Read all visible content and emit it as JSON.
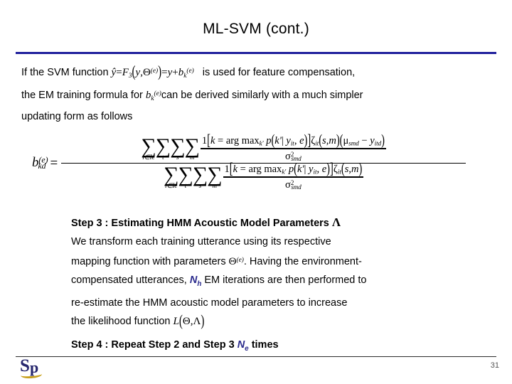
{
  "slide": {
    "title": "ML-SVM (cont.)",
    "page_number": "31",
    "accent_rule_color": "#1f1f9c",
    "footer_rule_color": "#2a2a2a",
    "highlight_variable_color": "#2a2a8c"
  },
  "logo": {
    "letter_s": "S",
    "letter_p": "p",
    "swoosh_color": "#c8a11e",
    "text_color": "#27276e"
  },
  "intro": {
    "line1_before": "If the SVM function",
    "line1_after": "is used for feature compensation,",
    "line2_before": "the EM training formula for",
    "line2_after": "can be derived similarly with a much simpler",
    "line3": "updating form as follows",
    "inline_formula_1": "ŷ = F3(y, Θ^(e)) = y + bk^(e)",
    "inline_formula_2": "bk^(e)",
    "f_label": "F",
    "f_sub": "3",
    "y_hat": "ŷ",
    "equals": "=",
    "y": "y",
    "theta": "Θ",
    "e_exp": "(e)",
    "plus": "+",
    "b": "b",
    "k_sub": "k",
    "comma": ","
  },
  "equation": {
    "lhs": "b",
    "lhs_sub": "kd",
    "lhs_sup": "(e)",
    "equals": "=",
    "numerator": {
      "sums": [
        {
          "sigma": "∑",
          "limit": "i∈Ie"
        },
        {
          "sigma": "∑",
          "limit": "t"
        },
        {
          "sigma": "∑",
          "limit": "s"
        },
        {
          "sigma": "∑",
          "limit": "m"
        }
      ],
      "frac_numerator": "1[k = arg maxk' p(k'| yit, e)] ζit(s, m)(μsmd − yitd)",
      "frac_denominator": "σ²smd",
      "parts": {
        "one": "1",
        "bracket_open": "[",
        "k": "k",
        "eq": "=",
        "argmax": "arg max",
        "kprime_sub": "k'",
        "p": "p",
        "paren_open": "(",
        "kprime": "k'",
        "bar": "|",
        "y": "y",
        "it_sub": "it",
        "comma": ",",
        "e": "e",
        "paren_close": ")",
        "bracket_close": "]",
        "zeta": "ζ",
        "s": "s",
        "m": "m",
        "mu": "μ",
        "smd_sub": "smd",
        "minus": "−",
        "itd_sub": "itd",
        "sigma": "σ",
        "sq": "2"
      }
    },
    "denominator": {
      "sums": [
        {
          "sigma": "∑",
          "limit": "i∈Ie"
        },
        {
          "sigma": "∑",
          "limit": "t"
        },
        {
          "sigma": "∑",
          "limit": "s"
        },
        {
          "sigma": "∑",
          "limit": "m"
        }
      ],
      "frac_numerator": "1[k = arg maxk' p(k'| yit, e)] ζit(s, m)",
      "frac_denominator": "σ²smd"
    }
  },
  "step3": {
    "heading_text": "Step 3 : Estimating HMM Acoustic Model Parameters",
    "heading_symbol": "Λ",
    "line1": "We transform each training utterance using its respective",
    "line2_before": "mapping function with parameters",
    "line2_formula": "Θ(e)",
    "line2_after": ". Having the environment-",
    "line3_before": "compensated utterances,",
    "line3_var": "N",
    "line3_var_sub": "h",
    "line3_after": "EM iterations are then performed to",
    "line4": "re-estimate the HMM acoustic model parameters to increase",
    "line5_before": "the likelihood function",
    "line5_formula": "L(Θ, Λ)",
    "theta": "Θ",
    "lambda": "Λ",
    "L": "L"
  },
  "step4": {
    "text_before": "Step 4 : Repeat Step 2 and Step 3",
    "var": "N",
    "var_sub": "e",
    "text_after": "times"
  }
}
